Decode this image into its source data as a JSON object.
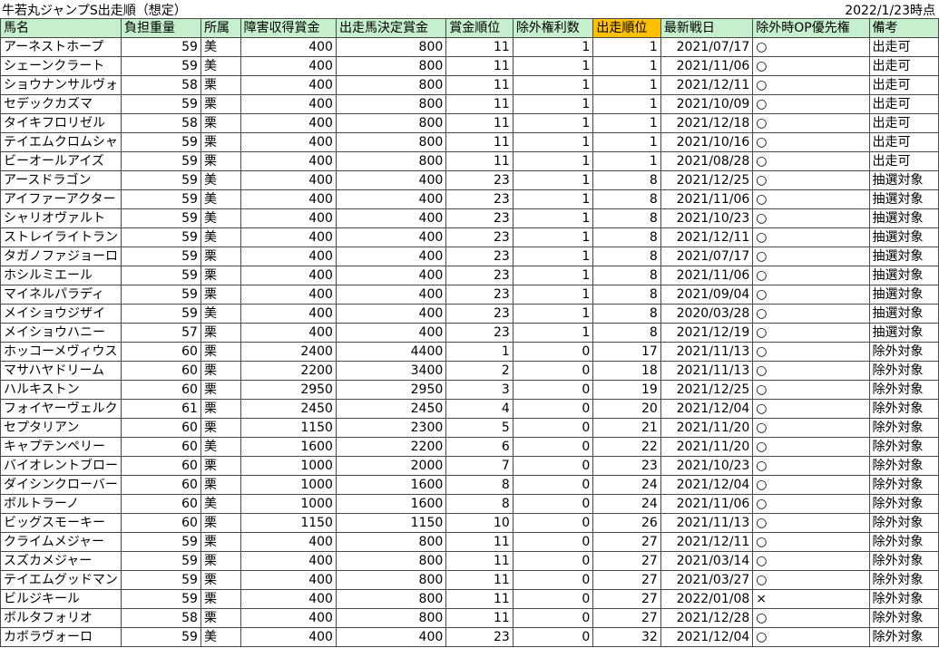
{
  "title": "牛若丸ジャンプS出走順（想定）",
  "as_of": "2022/1/23時点",
  "colors": {
    "header_bg": "#c6efce",
    "highlight_header_bg": "#ffc000",
    "border": "#4a4a4a"
  },
  "columns": [
    "馬名",
    "負担重量",
    "所属",
    "障害収得賞金",
    "出走馬決定賞金",
    "賞金順位",
    "除外権利数",
    "出走順位",
    "最新戦日",
    "除外時OP優先権",
    "備考"
  ],
  "rows": [
    [
      "アーネストホープ",
      "59",
      "美",
      "400",
      "800",
      "11",
      "1",
      "1",
      "2021/07/17",
      "○",
      "出走可"
    ],
    [
      "シェーンクラート",
      "59",
      "美",
      "400",
      "800",
      "11",
      "1",
      "1",
      "2021/11/06",
      "○",
      "出走可"
    ],
    [
      "ショウナンサルヴォ",
      "58",
      "栗",
      "400",
      "800",
      "11",
      "1",
      "1",
      "2021/12/11",
      "○",
      "出走可"
    ],
    [
      "セデックカズマ",
      "59",
      "栗",
      "400",
      "800",
      "11",
      "1",
      "1",
      "2021/10/09",
      "○",
      "出走可"
    ],
    [
      "タイキフロリゼル",
      "58",
      "栗",
      "400",
      "800",
      "11",
      "1",
      "1",
      "2021/12/18",
      "○",
      "出走可"
    ],
    [
      "テイエムクロムシャ",
      "59",
      "栗",
      "400",
      "800",
      "11",
      "1",
      "1",
      "2021/10/16",
      "○",
      "出走可"
    ],
    [
      "ビーオールアイズ",
      "59",
      "栗",
      "400",
      "800",
      "11",
      "1",
      "1",
      "2021/08/28",
      "○",
      "出走可"
    ],
    [
      "アースドラゴン",
      "59",
      "美",
      "400",
      "400",
      "23",
      "1",
      "8",
      "2021/12/25",
      "○",
      "抽選対象"
    ],
    [
      "アイファーアクター",
      "59",
      "美",
      "400",
      "400",
      "23",
      "1",
      "8",
      "2021/11/06",
      "○",
      "抽選対象"
    ],
    [
      "シャリオヴァルト",
      "59",
      "美",
      "400",
      "400",
      "23",
      "1",
      "8",
      "2021/10/23",
      "○",
      "抽選対象"
    ],
    [
      "ストレイライトラン",
      "59",
      "美",
      "400",
      "400",
      "23",
      "1",
      "8",
      "2021/12/11",
      "○",
      "抽選対象"
    ],
    [
      "タガノファジョーロ",
      "59",
      "栗",
      "400",
      "400",
      "23",
      "1",
      "8",
      "2021/07/17",
      "○",
      "抽選対象"
    ],
    [
      "ホシルミエール",
      "59",
      "栗",
      "400",
      "400",
      "23",
      "1",
      "8",
      "2021/11/06",
      "○",
      "抽選対象"
    ],
    [
      "マイネルパラディ",
      "59",
      "栗",
      "400",
      "400",
      "23",
      "1",
      "8",
      "2021/09/04",
      "○",
      "抽選対象"
    ],
    [
      "メイショウジザイ",
      "59",
      "美",
      "400",
      "400",
      "23",
      "1",
      "8",
      "2020/03/28",
      "○",
      "抽選対象"
    ],
    [
      "メイショウハニー",
      "57",
      "栗",
      "400",
      "400",
      "23",
      "1",
      "8",
      "2021/12/19",
      "○",
      "抽選対象"
    ],
    [
      "ホッコーメヴィウス",
      "60",
      "栗",
      "2400",
      "4400",
      "1",
      "0",
      "17",
      "2021/11/13",
      "○",
      "除外対象"
    ],
    [
      "マサハヤドリーム",
      "60",
      "栗",
      "2200",
      "3400",
      "2",
      "0",
      "18",
      "2021/11/13",
      "○",
      "除外対象"
    ],
    [
      "ハルキストン",
      "60",
      "栗",
      "2950",
      "2950",
      "3",
      "0",
      "19",
      "2021/12/25",
      "○",
      "除外対象"
    ],
    [
      "フォイヤーヴェルク",
      "61",
      "栗",
      "2450",
      "2450",
      "4",
      "0",
      "20",
      "2021/12/04",
      "○",
      "除外対象"
    ],
    [
      "セプタリアン",
      "60",
      "栗",
      "1150",
      "2300",
      "5",
      "0",
      "21",
      "2021/11/20",
      "○",
      "除外対象"
    ],
    [
      "キャプテンペリー",
      "60",
      "美",
      "1600",
      "2200",
      "6",
      "0",
      "22",
      "2021/11/20",
      "○",
      "除外対象"
    ],
    [
      "バイオレントブロー",
      "60",
      "栗",
      "1000",
      "2000",
      "7",
      "0",
      "23",
      "2021/10/23",
      "○",
      "除外対象"
    ],
    [
      "ダイシンクローバー",
      "60",
      "栗",
      "1000",
      "1600",
      "8",
      "0",
      "24",
      "2021/12/04",
      "○",
      "除外対象"
    ],
    [
      "ボルトラーノ",
      "60",
      "美",
      "1000",
      "1600",
      "8",
      "0",
      "24",
      "2021/11/06",
      "○",
      "除外対象"
    ],
    [
      "ビッグスモーキー",
      "60",
      "栗",
      "1150",
      "1150",
      "10",
      "0",
      "26",
      "2021/11/13",
      "○",
      "除外対象"
    ],
    [
      "クライムメジャー",
      "59",
      "栗",
      "400",
      "800",
      "11",
      "0",
      "27",
      "2021/12/11",
      "○",
      "除外対象"
    ],
    [
      "スズカメジャー",
      "59",
      "栗",
      "400",
      "800",
      "11",
      "0",
      "27",
      "2021/03/14",
      "○",
      "除外対象"
    ],
    [
      "テイエムグッドマン",
      "59",
      "栗",
      "400",
      "800",
      "11",
      "0",
      "27",
      "2021/03/27",
      "○",
      "除外対象"
    ],
    [
      "ビルジキール",
      "59",
      "栗",
      "400",
      "800",
      "11",
      "0",
      "27",
      "2022/01/08",
      "×",
      "除外対象"
    ],
    [
      "ボルタフォリオ",
      "58",
      "栗",
      "400",
      "800",
      "11",
      "0",
      "27",
      "2021/12/28",
      "○",
      "除外対象"
    ],
    [
      "カボラヴォーロ",
      "59",
      "美",
      "400",
      "400",
      "23",
      "0",
      "32",
      "2021/12/04",
      "○",
      "除外対象"
    ]
  ]
}
